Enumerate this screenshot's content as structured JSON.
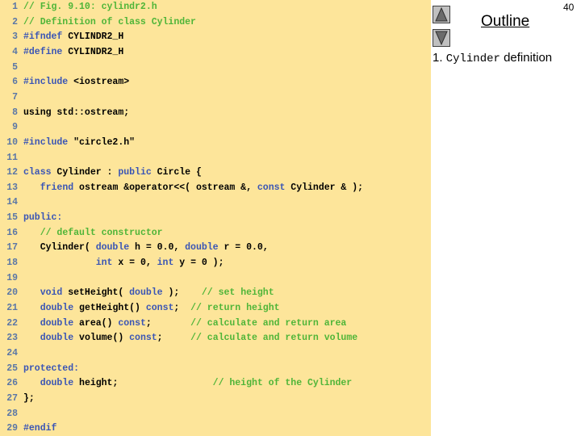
{
  "slide": {
    "page_number": "40",
    "outline_title": "Outline",
    "outline_items": [
      {
        "number": "1.",
        "code": "Cylinder",
        "text": "definition"
      }
    ],
    "nav": {
      "up_icon": "triangle-up-icon",
      "down_icon": "triangle-down-icon"
    }
  },
  "colors": {
    "code_background": "#fde59a",
    "keyword": "#3a55b5",
    "comment": "#4fb538",
    "text": "#000000",
    "line_number": "#5b77a6"
  },
  "code": {
    "lines": [
      {
        "n": "1",
        "tokens": [
          {
            "t": "cm",
            "v": "// Fig. 9.10: cylindr2.h"
          }
        ]
      },
      {
        "n": "2",
        "tokens": [
          {
            "t": "cm",
            "v": "// Definition of class Cylinder"
          }
        ]
      },
      {
        "n": "3",
        "tokens": [
          {
            "t": "kw",
            "v": "#ifndef"
          },
          {
            "t": "tx",
            "v": " CYLINDR2_H"
          }
        ]
      },
      {
        "n": "4",
        "tokens": [
          {
            "t": "kw",
            "v": "#define"
          },
          {
            "t": "tx",
            "v": " CYLINDR2_H"
          }
        ]
      },
      {
        "n": "5",
        "tokens": []
      },
      {
        "n": "6",
        "tokens": [
          {
            "t": "kw",
            "v": "#include"
          },
          {
            "t": "tx",
            "v": " <iostream>"
          }
        ]
      },
      {
        "n": "7",
        "tokens": []
      },
      {
        "n": "8",
        "tokens": [
          {
            "t": "tx",
            "v": "using std::ostream;"
          }
        ]
      },
      {
        "n": "9",
        "tokens": []
      },
      {
        "n": "10",
        "tokens": [
          {
            "t": "kw",
            "v": "#include"
          },
          {
            "t": "tx",
            "v": " \"circle2.h\""
          }
        ]
      },
      {
        "n": "11",
        "tokens": []
      },
      {
        "n": "12",
        "tokens": [
          {
            "t": "kw",
            "v": "class"
          },
          {
            "t": "tx",
            "v": " Cylinder : "
          },
          {
            "t": "kw",
            "v": "public"
          },
          {
            "t": "tx",
            "v": " Circle {"
          }
        ]
      },
      {
        "n": "13",
        "tokens": [
          {
            "t": "tx",
            "v": "   "
          },
          {
            "t": "kw",
            "v": "friend"
          },
          {
            "t": "tx",
            "v": " ostream &operator<<( ostream &, "
          },
          {
            "t": "kw",
            "v": "const"
          },
          {
            "t": "tx",
            "v": " Cylinder & );"
          }
        ]
      },
      {
        "n": "14",
        "tokens": []
      },
      {
        "n": "15",
        "tokens": [
          {
            "t": "kw",
            "v": "public:"
          }
        ]
      },
      {
        "n": "16",
        "tokens": [
          {
            "t": "tx",
            "v": "   "
          },
          {
            "t": "cm",
            "v": "// default constructor"
          }
        ]
      },
      {
        "n": "17",
        "tokens": [
          {
            "t": "tx",
            "v": "   Cylinder( "
          },
          {
            "t": "kw",
            "v": "double"
          },
          {
            "t": "tx",
            "v": " h = 0.0, "
          },
          {
            "t": "kw",
            "v": "double"
          },
          {
            "t": "tx",
            "v": " r = 0.0,"
          }
        ]
      },
      {
        "n": "18",
        "tokens": [
          {
            "t": "tx",
            "v": "             "
          },
          {
            "t": "kw",
            "v": "int"
          },
          {
            "t": "tx",
            "v": " x = 0, "
          },
          {
            "t": "kw",
            "v": "int"
          },
          {
            "t": "tx",
            "v": " y = 0 );"
          }
        ]
      },
      {
        "n": "19",
        "tokens": []
      },
      {
        "n": "20",
        "tokens": [
          {
            "t": "tx",
            "v": "   "
          },
          {
            "t": "kw",
            "v": "void"
          },
          {
            "t": "tx",
            "v": " setHeight( "
          },
          {
            "t": "kw",
            "v": "double"
          },
          {
            "t": "tx",
            "v": " );    "
          },
          {
            "t": "cm",
            "v": "// set height"
          }
        ]
      },
      {
        "n": "21",
        "tokens": [
          {
            "t": "tx",
            "v": "   "
          },
          {
            "t": "kw",
            "v": "double"
          },
          {
            "t": "tx",
            "v": " getHeight() "
          },
          {
            "t": "kw",
            "v": "const"
          },
          {
            "t": "tx",
            "v": ";  "
          },
          {
            "t": "cm",
            "v": "// return height"
          }
        ]
      },
      {
        "n": "22",
        "tokens": [
          {
            "t": "tx",
            "v": "   "
          },
          {
            "t": "kw",
            "v": "double"
          },
          {
            "t": "tx",
            "v": " area() "
          },
          {
            "t": "kw",
            "v": "const"
          },
          {
            "t": "tx",
            "v": ";       "
          },
          {
            "t": "cm",
            "v": "// calculate and return area"
          }
        ]
      },
      {
        "n": "23",
        "tokens": [
          {
            "t": "tx",
            "v": "   "
          },
          {
            "t": "kw",
            "v": "double"
          },
          {
            "t": "tx",
            "v": " volume() "
          },
          {
            "t": "kw",
            "v": "const"
          },
          {
            "t": "tx",
            "v": ";     "
          },
          {
            "t": "cm",
            "v": "// calculate and return volume"
          }
        ]
      },
      {
        "n": "24",
        "tokens": []
      },
      {
        "n": "25",
        "tokens": [
          {
            "t": "kw",
            "v": "protected:"
          }
        ]
      },
      {
        "n": "26",
        "tokens": [
          {
            "t": "tx",
            "v": "   "
          },
          {
            "t": "kw",
            "v": "double"
          },
          {
            "t": "tx",
            "v": " height;                 "
          },
          {
            "t": "cm",
            "v": "// height of the Cylinder"
          }
        ]
      },
      {
        "n": "27",
        "tokens": [
          {
            "t": "tx",
            "v": "};"
          }
        ]
      },
      {
        "n": "28",
        "tokens": []
      },
      {
        "n": "29",
        "tokens": [
          {
            "t": "kw",
            "v": "#endif"
          }
        ]
      }
    ]
  }
}
